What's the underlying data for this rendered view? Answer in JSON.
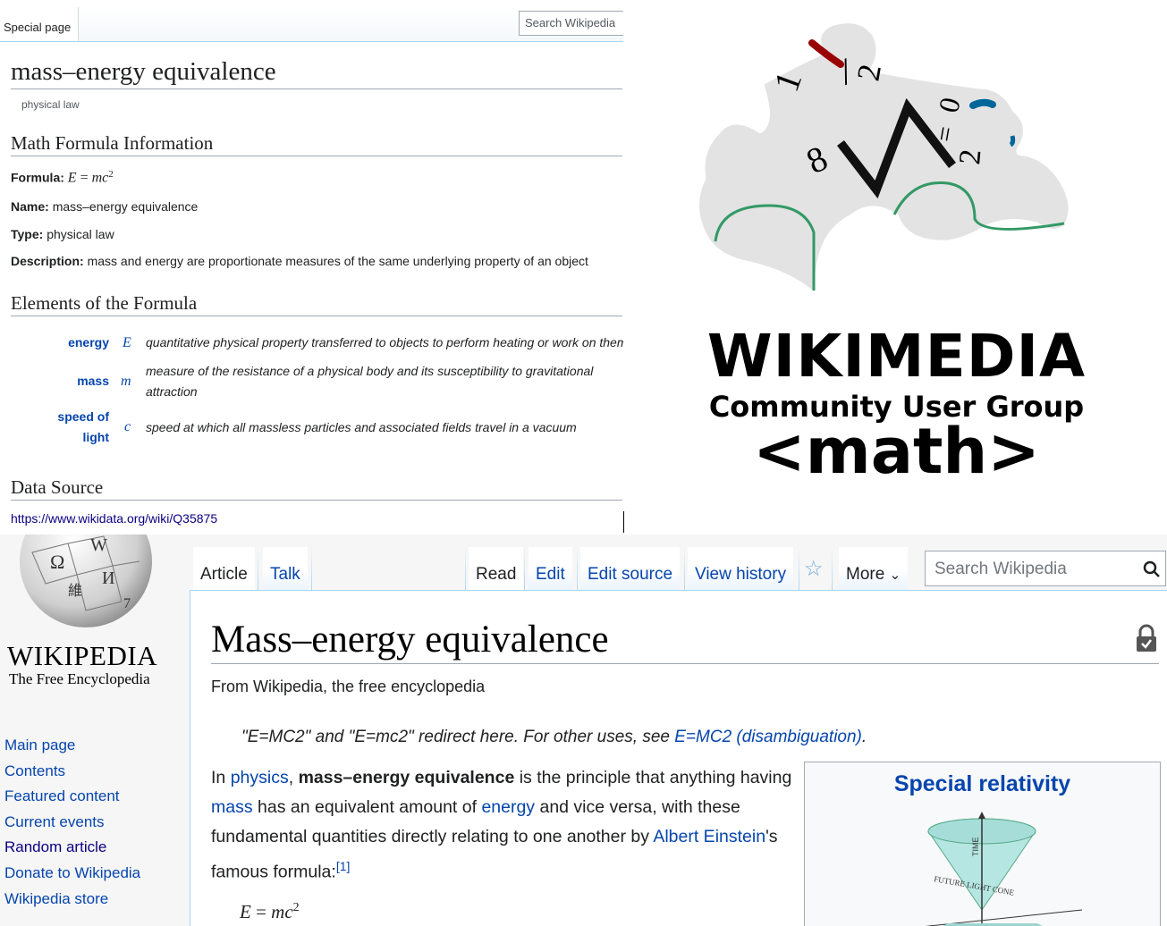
{
  "top_panel": {
    "tab_label": "Special page",
    "search_placeholder": "Search Wikipedia",
    "title": "mass–energy equivalence",
    "subtitle": "physical law",
    "section_info": "Math Formula Information",
    "formula_label": "Formula:",
    "formula_lhs": "E",
    "formula_eq": " = ",
    "formula_rhs": "mc",
    "formula_exp": "2",
    "name_label": "Name:",
    "name_value": "mass–energy equivalence",
    "type_label": "Type:",
    "type_value": "physical law",
    "description_label": "Description:",
    "description_value": "mass and energy are proportionate measures of the same underlying property of an object",
    "section_elements": "Elements of the Formula",
    "elements": [
      {
        "name": "energy",
        "symbol": "E",
        "desc": "quantitative physical property transferred to objects to perform heating or work on them"
      },
      {
        "name": "mass",
        "symbol": "m",
        "desc_line1": "measure of the resistance of a physical body and its susceptibility to gravitational",
        "desc_line2": "attraction"
      },
      {
        "name_line1": "speed of",
        "name_line2": "light",
        "symbol": "c",
        "desc": "speed at which all massless particles and associated fields travel in a vacuum"
      }
    ],
    "section_source": "Data Source",
    "source_url": "https://www.wikidata.org/wiki/Q35875"
  },
  "logo": {
    "title": "WIKIMEDIA",
    "subtitle": "Community User Group",
    "tag": "<math>",
    "colors": {
      "red": "#990000",
      "blue": "#006699",
      "green": "#339966"
    }
  },
  "wikipedia": {
    "wordmark": "WIKIPEDIA",
    "tagline": "The Free Encyclopedia",
    "nav": [
      "Main page",
      "Contents",
      "Featured content",
      "Current events",
      "Random article",
      "Donate to Wikipedia",
      "Wikipedia store"
    ],
    "tabs": {
      "article": "Article",
      "talk": "Talk",
      "read": "Read",
      "edit": "Edit",
      "edit_source": "Edit source",
      "view_history": "View history",
      "more": "More"
    },
    "search_placeholder": "Search Wikipedia",
    "title": "Mass–energy equivalence",
    "from": "From Wikipedia, the free encyclopedia",
    "hatnote_pre": "\"E=MC2\" and \"E=mc2\" redirect here. For other uses, see ",
    "hatnote_link": "E=MC2 (disambiguation)",
    "hatnote_post": ".",
    "para": {
      "t1": "In ",
      "l_physics": "physics",
      "t2": ", ",
      "b_term": "mass–energy equivalence",
      "t3": " is the principle that anything having ",
      "l_mass": "mass",
      "t4": " has an equivalent amount of ",
      "l_energy": "energy",
      "t5": " and vice versa, with these fundamental quantities directly relating to one another by ",
      "l_einstein": "Albert Einstein",
      "t6": "'s famous formula:",
      "ref": "[1]"
    },
    "formula_lhs": "E",
    "formula_eq": " = ",
    "formula_rhs": "mc",
    "formula_exp": "2",
    "infobox_title": "Special relativity",
    "diagram_time_label": "TIME",
    "diagram_cone_label": "FUTURE LIGHT CONE"
  }
}
